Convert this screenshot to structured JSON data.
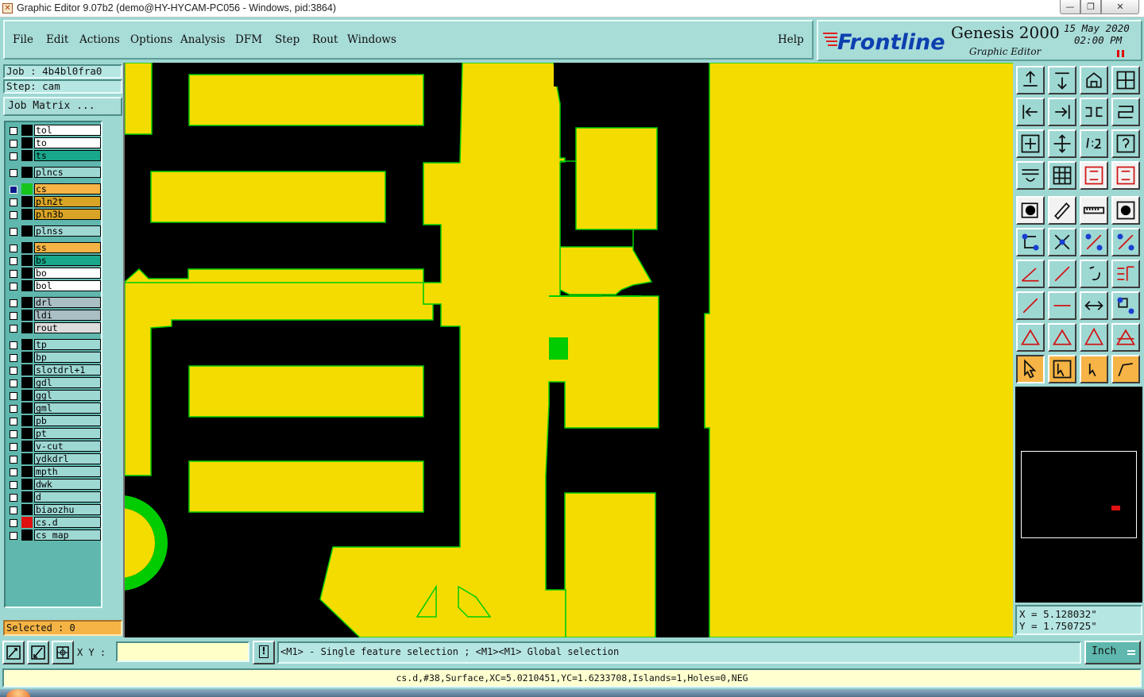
{
  "window": {
    "title": "Graphic Editor 9.07b2 (demo@HY-HYCAM-PC056 - Windows, pid:3864)",
    "min_label": "—",
    "max_label": "❐",
    "close_label": "✕"
  },
  "menu": {
    "items": [
      "File",
      "Edit",
      "Actions",
      "Options",
      "Analysis",
      "DFM",
      "Step",
      "Rout",
      "Windows"
    ],
    "help": "Help"
  },
  "brand": {
    "logo": "Frontline",
    "product": "Genesis 2000",
    "subtitle": "Graphic Editor",
    "date": "15 May 2020",
    "time": "02:00 PM"
  },
  "left": {
    "job": "Job : 4b4bl0fra0",
    "step": "Step: cam",
    "job_matrix": "Job Matrix ...",
    "selected": "Selected : 0"
  },
  "layers": [
    {
      "name": "tol",
      "color": "#ffffff",
      "swatch": "#000000"
    },
    {
      "name": "to",
      "color": "#ffffff",
      "swatch": "#000000"
    },
    {
      "name": "ts",
      "color": "#1aa88c",
      "swatch": "#000000"
    },
    {
      "name": "plncs",
      "color": "#9ed8d3",
      "swatch": "#000000"
    },
    {
      "name": "cs",
      "color": "#f5b445",
      "swatch": "#16c41a",
      "active": true
    },
    {
      "name": "pln2t",
      "color": "#d9a426",
      "swatch": "#000000"
    },
    {
      "name": "pln3b",
      "color": "#d9a426",
      "swatch": "#000000"
    },
    {
      "name": "plnss",
      "color": "#9ed8d3",
      "swatch": "#000000"
    },
    {
      "name": "ss",
      "color": "#f5b445",
      "swatch": "#000000"
    },
    {
      "name": "bs",
      "color": "#1aa88c",
      "swatch": "#000000"
    },
    {
      "name": "bo",
      "color": "#ffffff",
      "swatch": "#000000"
    },
    {
      "name": "bol",
      "color": "#ffffff",
      "swatch": "#000000"
    },
    {
      "name": "drl",
      "color": "#a9bfc3",
      "swatch": "#000000"
    },
    {
      "name": "ldi",
      "color": "#a9bfc3",
      "swatch": "#000000"
    },
    {
      "name": "rout",
      "color": "#dcdcdc",
      "swatch": "#000000"
    },
    {
      "name": "tp",
      "color": "#9ed8d3",
      "swatch": "#000000"
    },
    {
      "name": "bp",
      "color": "#9ed8d3",
      "swatch": "#000000"
    },
    {
      "name": "slotdrl+1",
      "color": "#9ed8d3",
      "swatch": "#000000"
    },
    {
      "name": "gdl",
      "color": "#9ed8d3",
      "swatch": "#000000"
    },
    {
      "name": "ggl",
      "color": "#9ed8d3",
      "swatch": "#000000"
    },
    {
      "name": "gml",
      "color": "#9ed8d3",
      "swatch": "#000000"
    },
    {
      "name": "pb",
      "color": "#9ed8d3",
      "swatch": "#000000"
    },
    {
      "name": "pt",
      "color": "#9ed8d3",
      "swatch": "#000000"
    },
    {
      "name": "v-cut",
      "color": "#9ed8d3",
      "swatch": "#000000"
    },
    {
      "name": "ydkdrl",
      "color": "#9ed8d3",
      "swatch": "#000000"
    },
    {
      "name": "mpth",
      "color": "#9ed8d3",
      "swatch": "#000000"
    },
    {
      "name": "dwk",
      "color": "#9ed8d3",
      "swatch": "#000000"
    },
    {
      "name": "d",
      "color": "#9ed8d3",
      "swatch": "#000000"
    },
    {
      "name": "biaozhu",
      "color": "#9ed8d3",
      "swatch": "#000000"
    },
    {
      "name": "cs.d",
      "color": "#9ed8d3",
      "swatch": "#e01010"
    },
    {
      "name": "cs_map",
      "color": "#9ed8d3",
      "swatch": "#000000"
    }
  ],
  "coords": {
    "x": "X = 5.128032\"",
    "y": "Y = 1.750725\""
  },
  "bottom": {
    "xy_label": "X Y :",
    "xy_value": "",
    "hint": "<M1> - Single feature selection ; <M1><M1> Global selection",
    "units": "Inch"
  },
  "status": "cs.d,#38,Surface,XC=5.0210451,YC=1.6233708,Islands=1,Holes=0,NEG",
  "colors": {
    "copper": "#f5dc00",
    "outline": "#00cc00",
    "background": "#000000",
    "panel": "#9ed8d3"
  },
  "icons": [
    "zoom-home-icon",
    "zoom-in-icon",
    "zoom-out-icon",
    "pan-icon",
    "snap-icon",
    "measure-icon",
    "select-icon",
    "redraw-icon",
    "help-icon",
    "route-icon",
    "grid-icon",
    "layer-icon"
  ]
}
